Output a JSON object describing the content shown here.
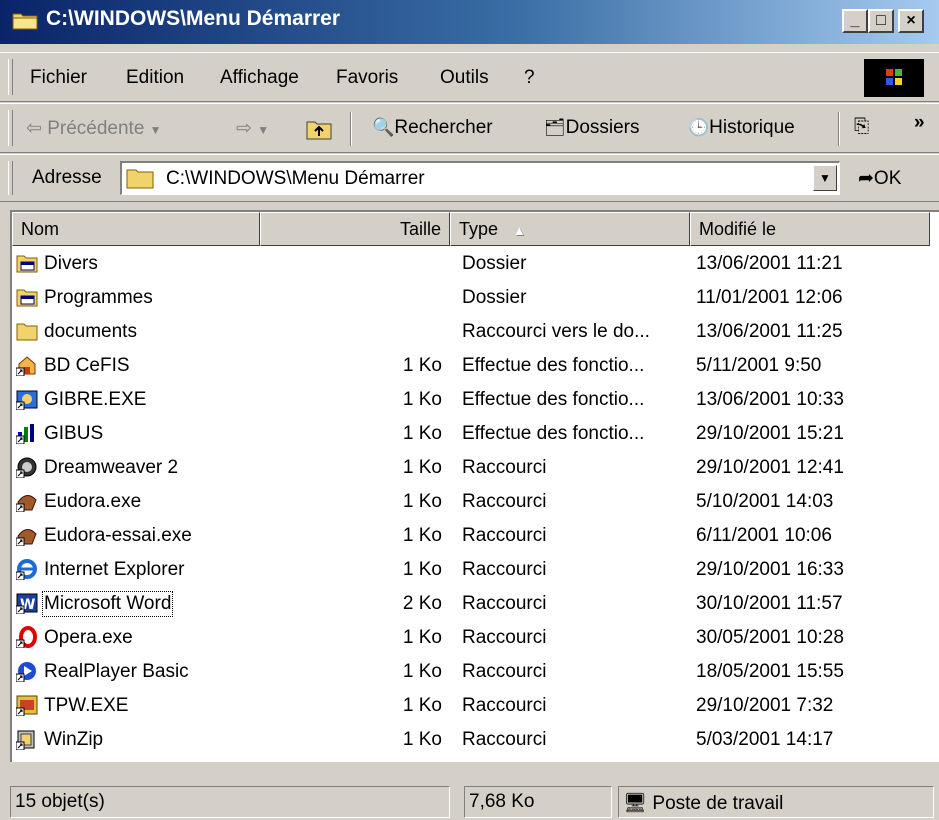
{
  "window": {
    "title": "C:\\WINDOWS\\Menu Démarrer",
    "minimize": "_",
    "maximize": "□",
    "close": "×"
  },
  "menu": [
    "Fichier",
    "Edition",
    "Affichage",
    "Favoris",
    "Outils",
    "?"
  ],
  "toolbar": {
    "back": "Précédente",
    "search": "Rechercher",
    "folders": "Dossiers",
    "history": "Historique",
    "more": "»"
  },
  "address": {
    "label": "Adresse",
    "value": "C:\\WINDOWS\\Menu Démarrer",
    "go": "OK"
  },
  "columns": {
    "name": "Nom",
    "size": "Taille",
    "type": "Type",
    "modified": "Modifié le"
  },
  "files": [
    {
      "name": "Divers",
      "size": "",
      "type": "Dossier",
      "modified": "13/06/2001 11:21",
      "icon": "folder-programs-icon"
    },
    {
      "name": "Programmes",
      "size": "",
      "type": "Dossier",
      "modified": "11/01/2001 12:06",
      "icon": "folder-programs-icon"
    },
    {
      "name": "documents",
      "size": "",
      "type": "Raccourci vers le do...",
      "modified": "13/06/2001 11:25",
      "icon": "folder-icon"
    },
    {
      "name": "BD CeFIS",
      "size": "1 Ko",
      "type": "Effectue des fonctio...",
      "modified": "5/11/2001 9:50",
      "icon": "database-icon"
    },
    {
      "name": "GIBRE.EXE",
      "size": "1 Ko",
      "type": "Effectue des fonctio...",
      "modified": "13/06/2001 10:33",
      "icon": "app-icon"
    },
    {
      "name": "GIBUS",
      "size": "1 Ko",
      "type": "Effectue des fonctio...",
      "modified": "29/10/2001 15:21",
      "icon": "chart-app-icon"
    },
    {
      "name": "Dreamweaver 2",
      "size": "1 Ko",
      "type": "Raccourci",
      "modified": "29/10/2001 12:41",
      "icon": "dreamweaver-icon"
    },
    {
      "name": "Eudora.exe",
      "size": "1 Ko",
      "type": "Raccourci",
      "modified": "5/10/2001 14:03",
      "icon": "eudora-icon"
    },
    {
      "name": "Eudora-essai.exe",
      "size": "1 Ko",
      "type": "Raccourci",
      "modified": "6/11/2001 10:06",
      "icon": "eudora-icon"
    },
    {
      "name": "Internet Explorer",
      "size": "1 Ko",
      "type": "Raccourci",
      "modified": "29/10/2001 16:33",
      "icon": "internet-explorer-icon"
    },
    {
      "name": "Microsoft Word",
      "size": "2 Ko",
      "type": "Raccourci",
      "modified": "30/10/2001 11:57",
      "icon": "word-icon"
    },
    {
      "name": "Opera.exe",
      "size": "1 Ko",
      "type": "Raccourci",
      "modified": "30/05/2001 10:28",
      "icon": "opera-icon"
    },
    {
      "name": "RealPlayer Basic",
      "size": "1 Ko",
      "type": "Raccourci",
      "modified": "18/05/2001 15:55",
      "icon": "realplayer-icon"
    },
    {
      "name": "TPW.EXE",
      "size": "1 Ko",
      "type": "Raccourci",
      "modified": "29/10/2001 7:32",
      "icon": "tpw-icon"
    },
    {
      "name": "WinZip",
      "size": "1 Ko",
      "type": "Raccourci",
      "modified": "5/03/2001 14:17",
      "icon": "winzip-icon"
    }
  ],
  "status": {
    "count": "15 objet(s)",
    "size": "7,68 Ko",
    "zone": "Poste de travail"
  },
  "colors": {
    "title_start": "#0a246a",
    "title_end": "#a6caf0",
    "face": "#d4d0c8"
  }
}
